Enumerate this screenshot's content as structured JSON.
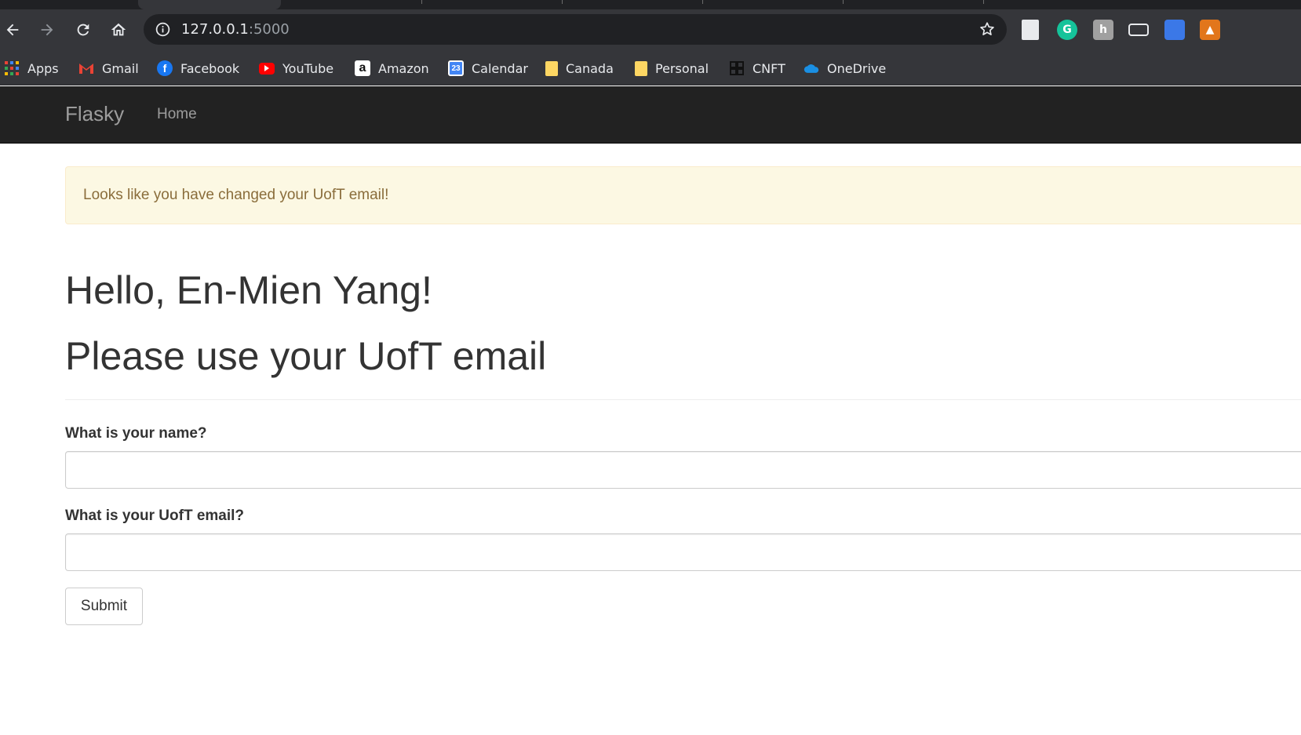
{
  "browser": {
    "url_host": "127.0.0.1",
    "url_port": ":5000",
    "icons": {
      "back": "arrow-left-icon",
      "forward": "arrow-right-icon",
      "reload": "reload-icon",
      "home": "home-icon",
      "info": "info-icon",
      "bookmark_star": "star-icon"
    },
    "extensions": [
      "document-icon",
      "grammarly-icon",
      "hypothesis-icon",
      "window-icon",
      "tab-manager-icon",
      "metamask-icon"
    ],
    "bookmarks": [
      {
        "label": "Apps",
        "icon": "apps-grid-icon"
      },
      {
        "label": "Gmail",
        "icon": "gmail-icon"
      },
      {
        "label": "Facebook",
        "icon": "facebook-icon"
      },
      {
        "label": "YouTube",
        "icon": "youtube-icon"
      },
      {
        "label": "Amazon",
        "icon": "amazon-icon"
      },
      {
        "label": "Calendar",
        "icon": "calendar-icon"
      },
      {
        "label": "Canada",
        "icon": "folder-icon"
      },
      {
        "label": "Personal",
        "icon": "folder-icon"
      },
      {
        "label": "CNFT",
        "icon": "cnft-icon"
      },
      {
        "label": "OneDrive",
        "icon": "onedrive-icon"
      }
    ]
  },
  "navbar": {
    "brand": "Flasky",
    "home_label": "Home"
  },
  "alert": {
    "message": "Looks like you have changed your UofT email!"
  },
  "main": {
    "greeting": "Hello, En-Mien Yang!",
    "subheading": "Please use your UofT email"
  },
  "form": {
    "name_label": "What is your name?",
    "name_value": "",
    "email_label": "What is your UofT email?",
    "email_value": "",
    "submit_label": "Submit"
  },
  "colors": {
    "navbar_bg": "#222222",
    "alert_bg": "#fcf8e3",
    "alert_text": "#8a6d3b",
    "text": "#333333"
  }
}
